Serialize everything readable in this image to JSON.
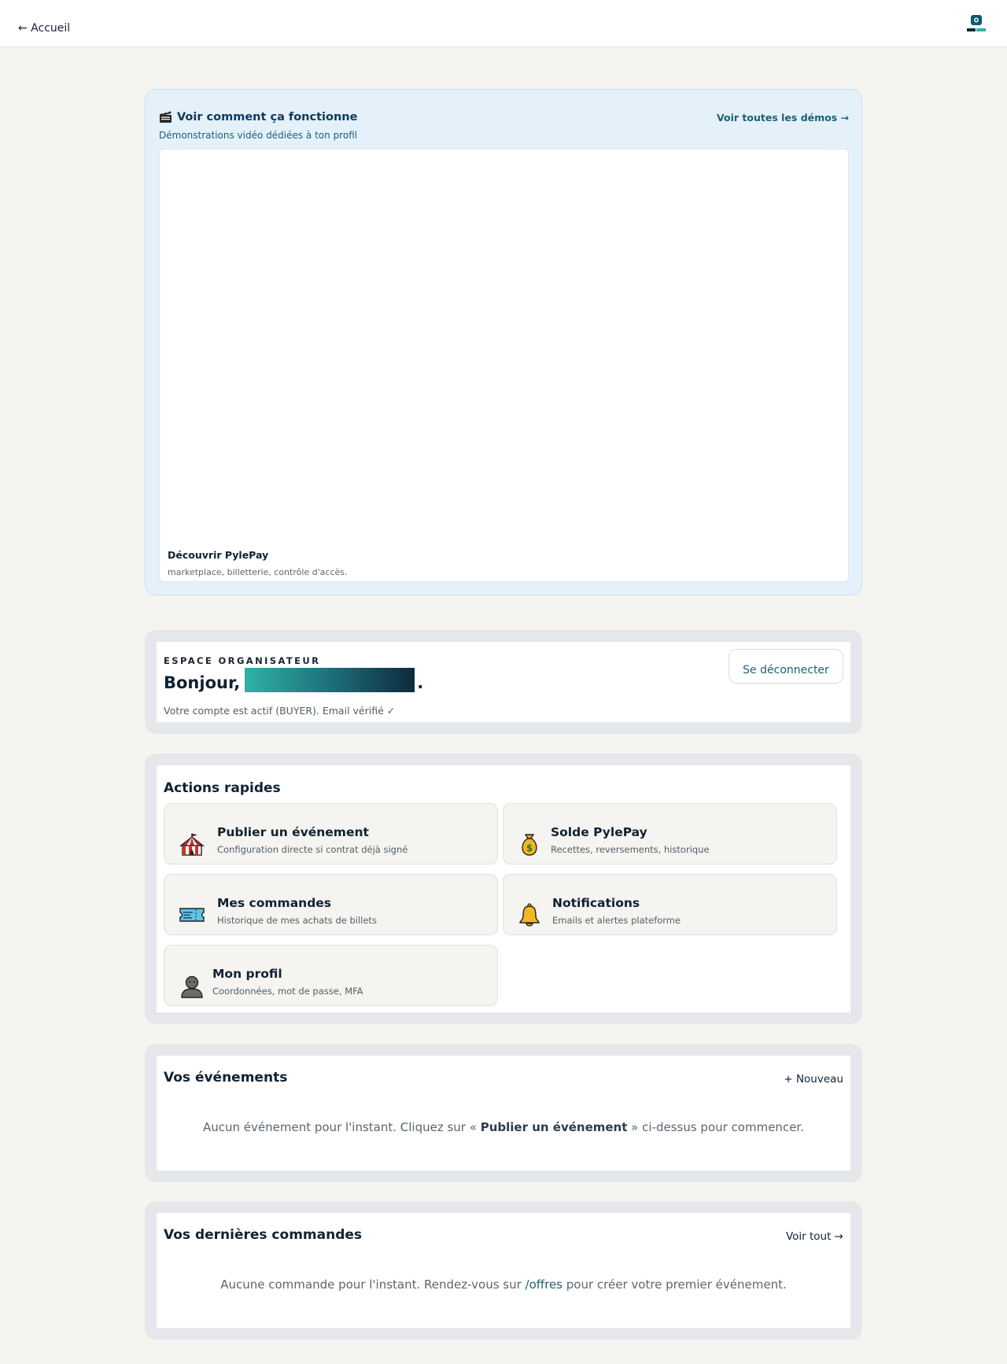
{
  "topbar": {
    "back_label": "← Accueil",
    "logo_text": "PylePay"
  },
  "demo": {
    "title": "Voir comment ça fonctionne",
    "subtitle": "Démonstrations vidéo dédiées à ton profil",
    "all_link": "Voir toutes les démos →",
    "video_title": "Découvrir PylePay",
    "video_desc": "marketplace, billetterie, contrôle d'accès."
  },
  "welcome": {
    "eyebrow": "ESPACE ORGANISATEUR",
    "greeting_prefix": "Bonjour,",
    "greeting_suffix": ".",
    "status": "Votre compte est actif (BUYER). Email vérifié ✓",
    "logout_label": "Se déconnecter"
  },
  "actions": {
    "title": "Actions rapides",
    "items": [
      {
        "title": "Publier un événement",
        "desc": "Configuration directe si contrat déjà signé",
        "icon": "circus-tent-icon"
      },
      {
        "title": "Solde PylePay",
        "desc": "Recettes, reversements, historique",
        "icon": "money-bag-icon"
      },
      {
        "title": "Mes commandes",
        "desc": "Historique de mes achats de billets",
        "icon": "ticket-icon"
      },
      {
        "title": "Notifications",
        "desc": "Emails et alertes plateforme",
        "icon": "bell-icon"
      },
      {
        "title": "Mon profil",
        "desc": "Coordonnées, mot de passe, MFA",
        "icon": "person-icon"
      }
    ]
  },
  "events": {
    "title": "Vos événements",
    "new_link": "+ Nouveau",
    "empty_before": "Aucun événement pour l'instant. Cliquez sur « ",
    "empty_bold": "Publier un événement",
    "empty_after": " » ci-dessus pour commencer."
  },
  "orders": {
    "title": "Vos dernières commandes",
    "all_link": "Voir tout →",
    "empty_before": "Aucune commande pour l'instant. Rendez-vous sur ",
    "empty_link": "/offres",
    "empty_after": " pour créer votre premier événement."
  },
  "colors": {
    "accent": "#1e5f74",
    "background": "#f5f4f0",
    "demo_background": "#e4f1fb"
  }
}
